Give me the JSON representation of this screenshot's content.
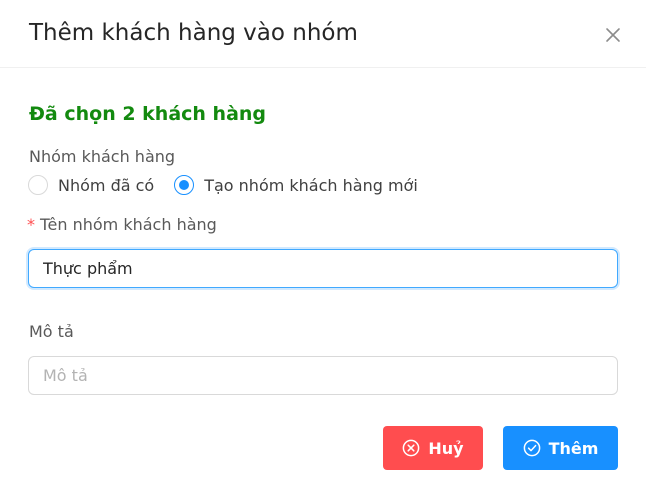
{
  "modal": {
    "title": "Thêm khách hàng vào nhóm",
    "close_icon": "close-icon"
  },
  "selected_count_text": "Đã chọn 2 khách hàng",
  "customer_group": {
    "label": "Nhóm khách hàng",
    "options": [
      {
        "label": "Nhóm đã có",
        "checked": false
      },
      {
        "label": "Tạo nhóm khách hàng mới",
        "checked": true
      }
    ]
  },
  "group_name": {
    "required_mark": "*",
    "label": "Tên nhóm khách hàng",
    "value": "Thực phẩm"
  },
  "description": {
    "label": "Mô tả",
    "placeholder": "Mô tả",
    "value": ""
  },
  "footer": {
    "cancel_label": "Huỷ",
    "cancel_icon": "close-circle-icon",
    "submit_label": "Thêm",
    "submit_icon": "check-circle-icon"
  },
  "colors": {
    "success_text": "#138a0f",
    "primary": "#1890ff",
    "danger": "#ff4d4f"
  }
}
